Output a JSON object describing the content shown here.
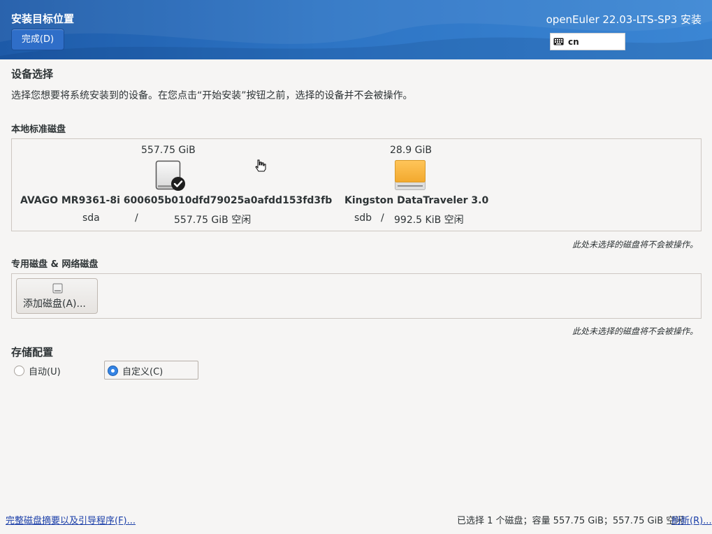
{
  "header": {
    "page_title": "安装目标位置",
    "done_button": "完成(D)",
    "product_title": "openEuler 22.03-LTS-SP3 安装",
    "keyboard_layout": "cn",
    "keyboard_icon": "keyboard-icon"
  },
  "device_selection": {
    "title": "设备选择",
    "description": "选择您想要将系统安装到的设备。在您点击“开始安装”按钮之前，选择的设备并不会被操作。"
  },
  "local_disks": {
    "title": "本地标准磁盘",
    "disks": [
      {
        "size": "557.75 GiB",
        "name": "AVAGO MR9361-8i 600605b010dfd79025a0afdd153fd3fb",
        "device": "sda",
        "separator": "/",
        "free": "557.75 GiB 空闲",
        "selected": true,
        "icon": "hard-disk-icon"
      },
      {
        "size": "28.9 GiB",
        "name": "Kingston DataTraveler 3.0",
        "device": "sdb",
        "separator": "/",
        "free": "992.5 KiB 空闲",
        "selected": false,
        "icon": "usb-disk-icon"
      }
    ],
    "note": "此处未选择的磁盘将不会被操作。"
  },
  "specialized_disks": {
    "title": "专用磁盘 & 网络磁盘",
    "add_button": "添加磁盘(A)...",
    "note": "此处未选择的磁盘将不会被操作。"
  },
  "storage_config": {
    "title": "存储配置",
    "options": [
      {
        "label": "自动(U)",
        "checked": false
      },
      {
        "label": "自定义(C)",
        "checked": true
      }
    ]
  },
  "footer": {
    "summary_link": "完整磁盘摘要以及引导程序(F)...",
    "status": "已选择 1 个磁盘；容量 557.75 GiB；557.75 GiB 空闲",
    "refresh_link": "刷新(R)..."
  },
  "colors": {
    "header_blue": "#2d74c4",
    "accent": "#3584e4",
    "usb_orange": "#f5b840"
  }
}
